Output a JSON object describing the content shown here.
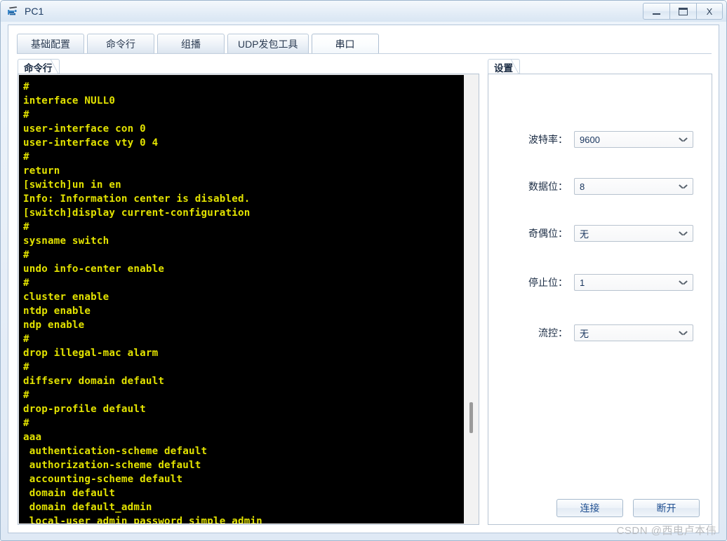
{
  "window": {
    "title": "PC1",
    "icon": "device-pc-icon",
    "controls": {
      "minimize": "–",
      "maximize": "□",
      "close": "X"
    }
  },
  "tabs": [
    {
      "label": "基础配置",
      "active": false
    },
    {
      "label": "命令行",
      "active": false
    },
    {
      "label": "组播",
      "active": false
    },
    {
      "label": "UDP发包工具",
      "active": false
    },
    {
      "label": "串口",
      "active": true
    }
  ],
  "left_panel": {
    "group_title": "命令行",
    "terminal": {
      "text_color": "#e2e200",
      "background_color": "#000000",
      "lines": [
        "#",
        "interface NULL0",
        "#",
        "user-interface con 0",
        "user-interface vty 0 4",
        "#",
        "return",
        "[switch]un in en",
        "Info: Information center is disabled.",
        "[switch]display current-configuration",
        "#",
        "sysname switch",
        "#",
        "undo info-center enable",
        "#",
        "cluster enable",
        "ntdp enable",
        "ndp enable",
        "#",
        "drop illegal-mac alarm",
        "#",
        "diffserv domain default",
        "#",
        "drop-profile default",
        "#",
        "aaa",
        " authentication-scheme default",
        " authorization-scheme default",
        " accounting-scheme default",
        " domain default",
        " domain default_admin",
        " local-user admin password simple admin"
      ]
    },
    "scrollbar": {
      "name": "vertical-scrollbar"
    }
  },
  "right_panel": {
    "group_title": "设置",
    "fields": [
      {
        "label": "波特率：",
        "value": "9600",
        "name": "baud-rate"
      },
      {
        "label": "数据位：",
        "value": "8",
        "name": "data-bits"
      },
      {
        "label": "奇偶位：",
        "value": "无",
        "name": "parity"
      },
      {
        "label": "停止位：",
        "value": "1",
        "name": "stop-bits"
      },
      {
        "label": "流控：",
        "value": "无",
        "name": "flow-control"
      }
    ],
    "buttons": {
      "connect": "连接",
      "disconnect": "断开"
    }
  },
  "watermark": "CSDN @西电卢本伟",
  "colors": {
    "frame": "#dfe9f5",
    "terminal_text": "#e2e200",
    "button_text": "#1f4f91",
    "accent_border": "#b7c4d3"
  }
}
